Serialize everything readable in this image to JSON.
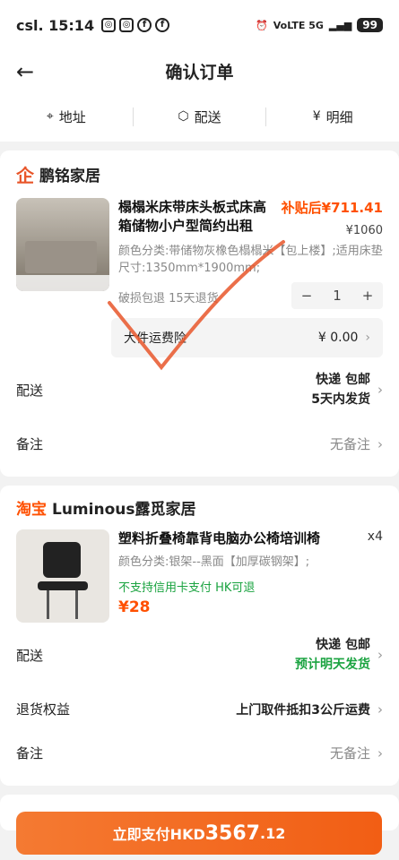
{
  "status_bar": {
    "carrier_time": "csl. 15:14",
    "battery": "99",
    "network": "VoLTE 5G"
  },
  "header": {
    "title": "确认订单"
  },
  "tabs": [
    {
      "label": "地址"
    },
    {
      "label": "配送"
    },
    {
      "label": "明细"
    }
  ],
  "shop1": {
    "name": "鹏铭家居",
    "item": {
      "name": "榻榻米床带床头板式床高箱储物小户型简约出租",
      "subsidy_price": "补贴后¥711.41",
      "original_price": "¥1060",
      "spec": "颜色分类:带储物灰橡色榻榻米【包上楼】;适用床垫尺寸:1350mm*1900mm;",
      "service": "破损包退 15天退货",
      "qty": "1"
    },
    "insurance": {
      "label": "大件运费险",
      "value": "¥ 0.00"
    },
    "delivery": {
      "label": "配送",
      "line1": "快递 包邮",
      "line2": "5天内发货"
    },
    "note": {
      "label": "备注",
      "value": "无备注"
    }
  },
  "shop2": {
    "name": "Luminous露觅家居",
    "item": {
      "name": "塑料折叠椅靠背电脑办公椅培训椅",
      "qty": "x4",
      "spec": "颜色分类:银架--黑面【加厚碳钢架】;",
      "tags": "不支持信用卡支付 HK可退",
      "price": "¥28"
    },
    "delivery": {
      "label": "配送",
      "line1": "快递 包邮",
      "line2": "预计明天发货"
    },
    "returns": {
      "label": "退货权益",
      "value": "上门取件抵扣3公斤运费"
    },
    "note": {
      "label": "备注",
      "value": "无备注"
    }
  },
  "pay": {
    "label": "立即支付HKD",
    "amount": "3567",
    "decimal": ".12"
  }
}
